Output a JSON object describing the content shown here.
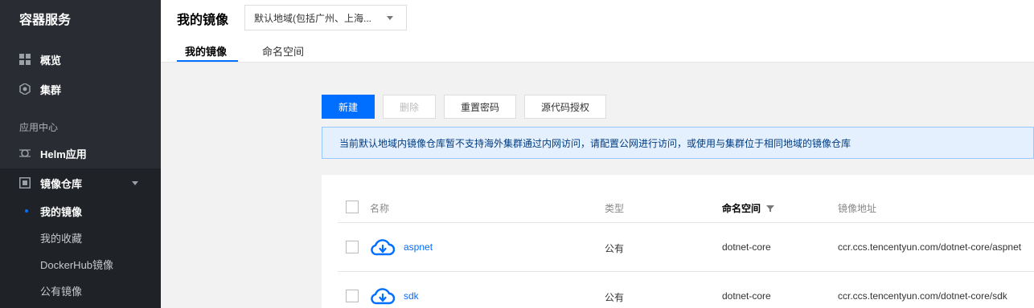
{
  "sidebar": {
    "title": "容器服务",
    "items": [
      {
        "label": "概览",
        "icon": "grid-icon"
      },
      {
        "label": "集群",
        "icon": "cluster-icon"
      }
    ],
    "section_label": "应用中心",
    "helm": {
      "label": "Helm应用",
      "icon": "helm-icon"
    },
    "registry": {
      "label": "镜像仓库",
      "icon": "registry-icon",
      "children": [
        {
          "label": "我的镜像",
          "active": true
        },
        {
          "label": "我的收藏"
        },
        {
          "label": "DockerHub镜像"
        },
        {
          "label": "公有镜像"
        }
      ]
    }
  },
  "header": {
    "title": "我的镜像",
    "region_value": "默认地域(包括广州、上海...",
    "tabs": [
      {
        "label": "我的镜像",
        "active": true
      },
      {
        "label": "命名空间"
      }
    ]
  },
  "toolbar": {
    "new_label": "新建",
    "delete_label": "删除",
    "reset_password_label": "重置密码",
    "source_auth_label": "源代码授权"
  },
  "notice": {
    "text": "当前默认地域内镜像仓库暂不支持海外集群通过内网访问，请配置公网进行访问，或使用与集群位于相同地域的镜像仓库"
  },
  "table": {
    "headers": {
      "name": "名称",
      "type": "类型",
      "namespace": "命名空间",
      "address": "镜像地址"
    },
    "rows": [
      {
        "name": "aspnet",
        "type": "公有",
        "namespace": "dotnet-core",
        "address": "ccr.ccs.tencentyun.com/dotnet-core/aspnet"
      },
      {
        "name": "sdk",
        "type": "公有",
        "namespace": "dotnet-core",
        "address": "ccr.ccs.tencentyun.com/dotnet-core/sdk"
      }
    ]
  },
  "colors": {
    "accent": "#006eff",
    "sidebar_bg": "#292d33",
    "notice_bg": "#e5f0ff"
  }
}
